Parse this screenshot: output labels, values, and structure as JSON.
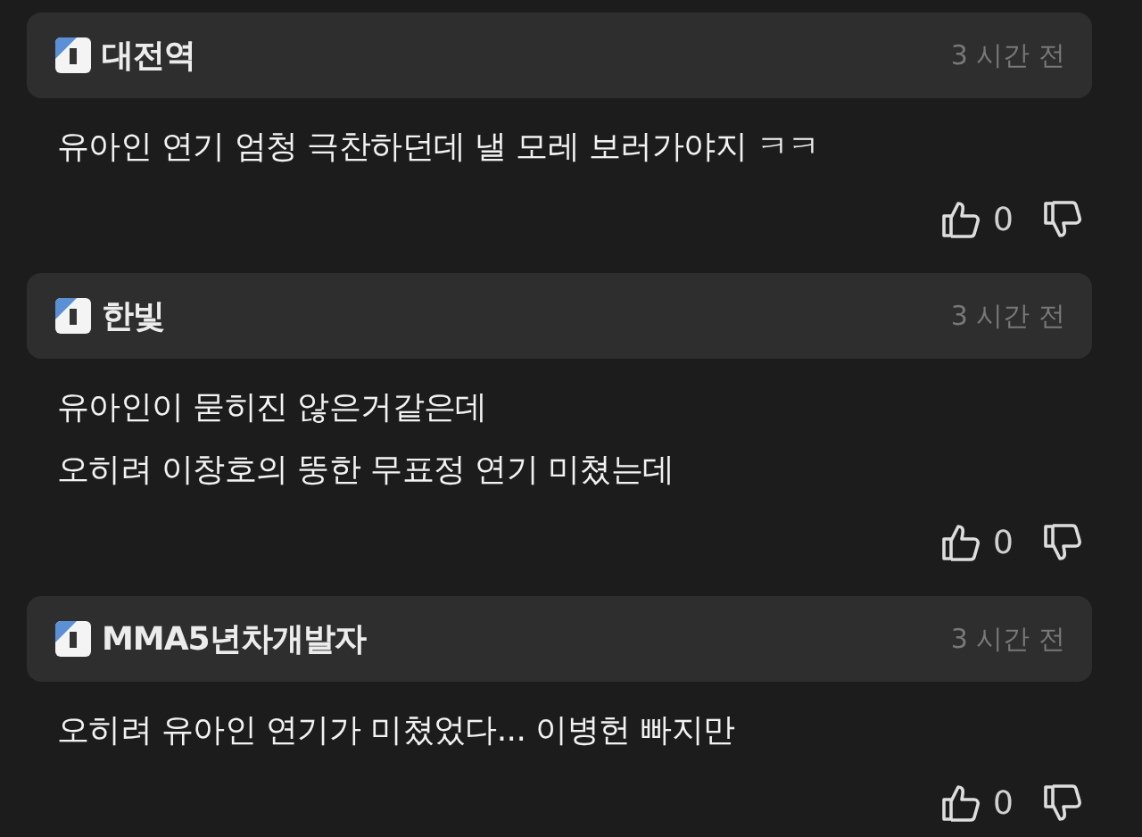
{
  "comments": [
    {
      "author": "대전역",
      "time": "3 시간 전",
      "lines": [
        "유아인 연기 엄청 극찬하던데 낼 모레 보러가야지 ㅋㅋ"
      ],
      "likes": "0"
    },
    {
      "author": "한빛",
      "time": "3 시간 전",
      "lines": [
        "유아인이 묻히진 않은거같은데",
        "오히려 이창호의 뚱한 무표정 연기 미쳤는데"
      ],
      "likes": "0"
    },
    {
      "author": "MMA5년차개발자",
      "time": "3 시간 전",
      "lines": [
        "오히려 유아인 연기가 미쳤었다... 이병헌 빠지만"
      ],
      "likes": "0"
    }
  ]
}
